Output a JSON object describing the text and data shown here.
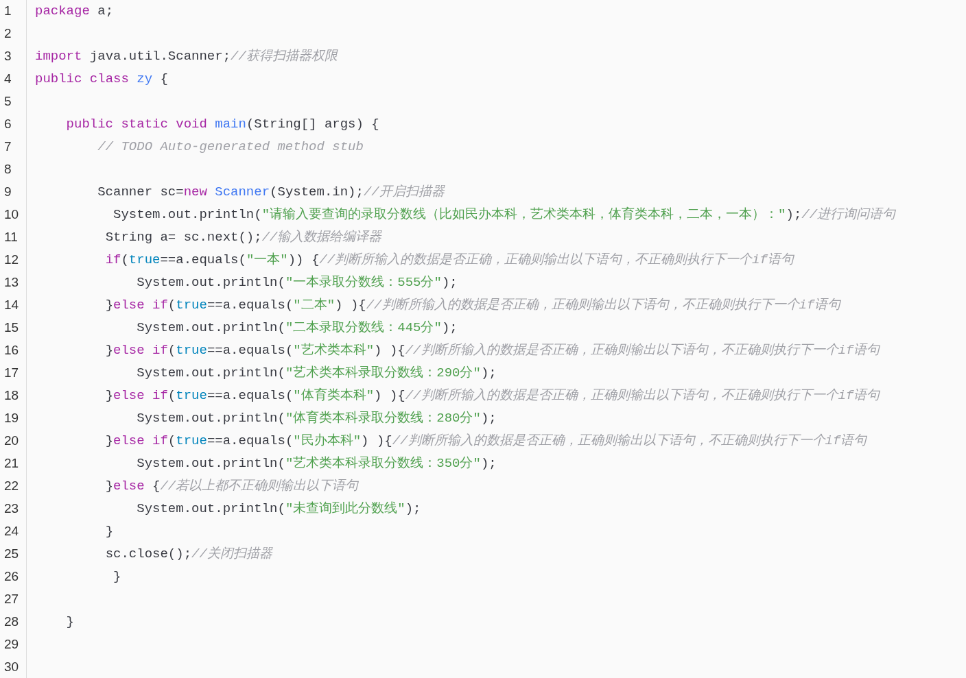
{
  "editor": {
    "lines": [
      {
        "number": "1",
        "tokens": [
          {
            "kind": "keyword",
            "text": "package"
          },
          {
            "kind": "plain",
            "text": " a;"
          }
        ]
      },
      {
        "number": "2"
      },
      {
        "number": "3",
        "tokens": [
          {
            "kind": "keyword",
            "text": "import"
          },
          {
            "kind": "plain",
            "text": " java.util.Scanner;"
          },
          {
            "kind": "comment",
            "text": "//获得扫描器权限"
          }
        ]
      },
      {
        "number": "4",
        "tokens": [
          {
            "kind": "keyword",
            "text": "public"
          },
          {
            "kind": "keyword",
            "text": " class"
          },
          {
            "kind": "name",
            "text": " zy"
          },
          {
            "kind": "plain",
            "text": " {"
          }
        ]
      },
      {
        "number": "5"
      },
      {
        "number": "6",
        "tokens": [
          {
            "kind": "keyword",
            "text": "    public"
          },
          {
            "kind": "keyword",
            "text": " static"
          },
          {
            "kind": "keyword",
            "text": " void"
          },
          {
            "kind": "name",
            "text": " main"
          },
          {
            "kind": "plain",
            "text": "(String[] args) {"
          }
        ]
      },
      {
        "number": "7",
        "tokens": [
          {
            "kind": "comment",
            "text": "        // TODO Auto-generated method stub"
          }
        ]
      },
      {
        "number": "8"
      },
      {
        "number": "9",
        "tokens": [
          {
            "kind": "plain",
            "text": "        Scanner sc="
          },
          {
            "kind": "keyword",
            "text": "new"
          },
          {
            "kind": "name",
            "text": " Scanner"
          },
          {
            "kind": "plain",
            "text": "(System.in);"
          },
          {
            "kind": "comment",
            "text": "//开启扫描器"
          }
        ]
      },
      {
        "number": "10",
        "tokens": [
          {
            "kind": "plain",
            "text": "          System.out.println("
          },
          {
            "kind": "string",
            "text": "\"请输入要查询的录取分数线（比如民办本科，艺术类本科，体育类本科，二本，一本）：\""
          },
          {
            "kind": "plain",
            "text": ");"
          },
          {
            "kind": "comment",
            "text": "//进行询问语句"
          }
        ]
      },
      {
        "number": "11",
        "tokens": [
          {
            "kind": "plain",
            "text": "         String a= sc.next();"
          },
          {
            "kind": "comment",
            "text": "//输入数据给编译器"
          }
        ]
      },
      {
        "number": "12",
        "tokens": [
          {
            "kind": "keyword",
            "text": "         if"
          },
          {
            "kind": "plain",
            "text": "("
          },
          {
            "kind": "literal",
            "text": "true"
          },
          {
            "kind": "plain",
            "text": "==a.equals("
          },
          {
            "kind": "string",
            "text": "\"一本\""
          },
          {
            "kind": "plain",
            "text": ")) {"
          },
          {
            "kind": "comment",
            "text": "//判断所输入的数据是否正确，正确则输出以下语句，不正确则执行下一个if语句"
          }
        ]
      },
      {
        "number": "13",
        "tokens": [
          {
            "kind": "plain",
            "text": "             System.out.println("
          },
          {
            "kind": "string",
            "text": "\"一本录取分数线：555分\""
          },
          {
            "kind": "plain",
            "text": ");"
          }
        ]
      },
      {
        "number": "14",
        "tokens": [
          {
            "kind": "plain",
            "text": "         }"
          },
          {
            "kind": "keyword",
            "text": "else"
          },
          {
            "kind": "keyword",
            "text": " if"
          },
          {
            "kind": "plain",
            "text": "("
          },
          {
            "kind": "literal",
            "text": "true"
          },
          {
            "kind": "plain",
            "text": "==a.equals("
          },
          {
            "kind": "string",
            "text": "\"二本\""
          },
          {
            "kind": "plain",
            "text": ") ){"
          },
          {
            "kind": "comment",
            "text": "//判断所输入的数据是否正确，正确则输出以下语句，不正确则执行下一个if语句"
          }
        ]
      },
      {
        "number": "15",
        "tokens": [
          {
            "kind": "plain",
            "text": "             System.out.println("
          },
          {
            "kind": "string",
            "text": "\"二本录取分数线：445分\""
          },
          {
            "kind": "plain",
            "text": ");"
          }
        ]
      },
      {
        "number": "16",
        "tokens": [
          {
            "kind": "plain",
            "text": "         }"
          },
          {
            "kind": "keyword",
            "text": "else"
          },
          {
            "kind": "keyword",
            "text": " if"
          },
          {
            "kind": "plain",
            "text": "("
          },
          {
            "kind": "literal",
            "text": "true"
          },
          {
            "kind": "plain",
            "text": "==a.equals("
          },
          {
            "kind": "string",
            "text": "\"艺术类本科\""
          },
          {
            "kind": "plain",
            "text": ") ){"
          },
          {
            "kind": "comment",
            "text": "//判断所输入的数据是否正确，正确则输出以下语句，不正确则执行下一个if语句"
          }
        ]
      },
      {
        "number": "17",
        "tokens": [
          {
            "kind": "plain",
            "text": "             System.out.println("
          },
          {
            "kind": "string",
            "text": "\"艺术类本科录取分数线：290分\""
          },
          {
            "kind": "plain",
            "text": ");"
          }
        ]
      },
      {
        "number": "18",
        "tokens": [
          {
            "kind": "plain",
            "text": "         }"
          },
          {
            "kind": "keyword",
            "text": "else"
          },
          {
            "kind": "keyword",
            "text": " if"
          },
          {
            "kind": "plain",
            "text": "("
          },
          {
            "kind": "literal",
            "text": "true"
          },
          {
            "kind": "plain",
            "text": "==a.equals("
          },
          {
            "kind": "string",
            "text": "\"体育类本科\""
          },
          {
            "kind": "plain",
            "text": ") ){"
          },
          {
            "kind": "comment",
            "text": "//判断所输入的数据是否正确，正确则输出以下语句，不正确则执行下一个if语句"
          }
        ]
      },
      {
        "number": "19",
        "tokens": [
          {
            "kind": "plain",
            "text": "             System.out.println("
          },
          {
            "kind": "string",
            "text": "\"体育类本科录取分数线：280分\""
          },
          {
            "kind": "plain",
            "text": ");"
          }
        ]
      },
      {
        "number": "20",
        "tokens": [
          {
            "kind": "plain",
            "text": "         }"
          },
          {
            "kind": "keyword",
            "text": "else"
          },
          {
            "kind": "keyword",
            "text": " if"
          },
          {
            "kind": "plain",
            "text": "("
          },
          {
            "kind": "literal",
            "text": "true"
          },
          {
            "kind": "plain",
            "text": "==a.equals("
          },
          {
            "kind": "string",
            "text": "\"民办本科\""
          },
          {
            "kind": "plain",
            "text": ") ){"
          },
          {
            "kind": "comment",
            "text": "//判断所输入的数据是否正确，正确则输出以下语句，不正确则执行下一个if语句"
          }
        ]
      },
      {
        "number": "21",
        "tokens": [
          {
            "kind": "plain",
            "text": "             System.out.println("
          },
          {
            "kind": "string",
            "text": "\"艺术类本科录取分数线：350分\""
          },
          {
            "kind": "plain",
            "text": ");"
          }
        ]
      },
      {
        "number": "22",
        "tokens": [
          {
            "kind": "plain",
            "text": "         }"
          },
          {
            "kind": "keyword",
            "text": "else"
          },
          {
            "kind": "plain",
            "text": " {"
          },
          {
            "kind": "comment",
            "text": "//若以上都不正确则输出以下语句"
          }
        ]
      },
      {
        "number": "23",
        "tokens": [
          {
            "kind": "plain",
            "text": "             System.out.println("
          },
          {
            "kind": "string",
            "text": "\"未查询到此分数线\""
          },
          {
            "kind": "plain",
            "text": ");"
          }
        ]
      },
      {
        "number": "24",
        "tokens": [
          {
            "kind": "plain",
            "text": "         }"
          }
        ]
      },
      {
        "number": "25",
        "tokens": [
          {
            "kind": "plain",
            "text": "         sc.close();"
          },
          {
            "kind": "comment",
            "text": "//关闭扫描器"
          }
        ]
      },
      {
        "number": "26",
        "tokens": [
          {
            "kind": "plain",
            "text": "          }"
          }
        ]
      },
      {
        "number": "27"
      },
      {
        "number": "28",
        "tokens": [
          {
            "kind": "plain",
            "text": "    }"
          }
        ]
      },
      {
        "number": "29"
      },
      {
        "number": "30"
      }
    ]
  }
}
